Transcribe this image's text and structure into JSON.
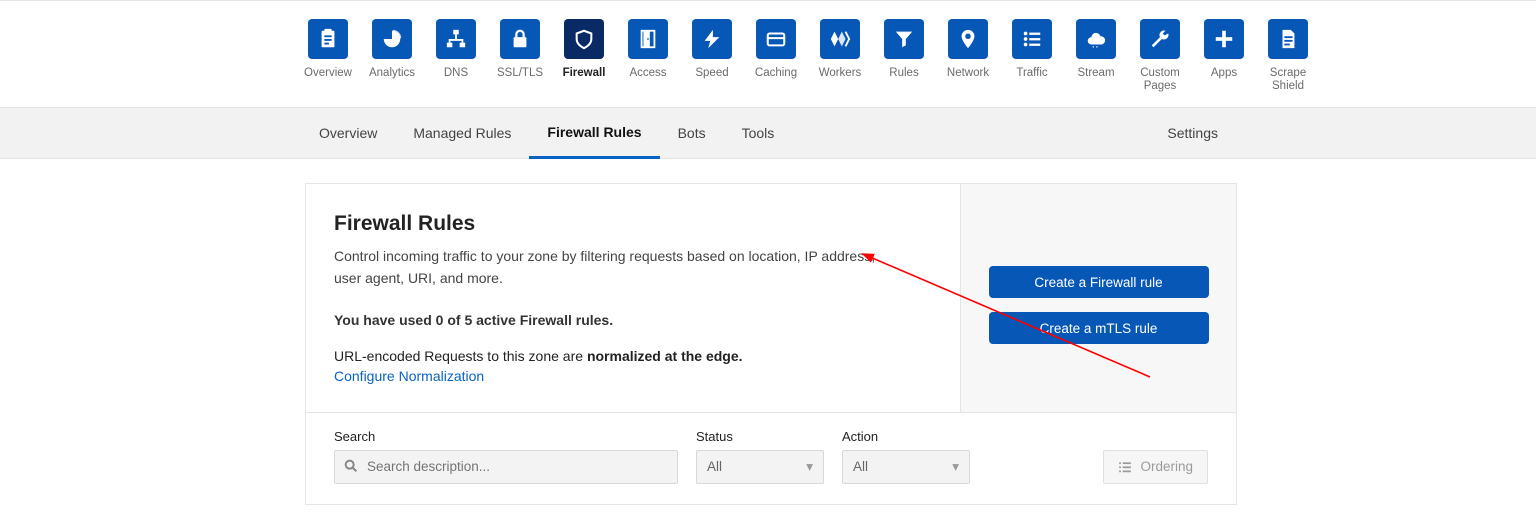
{
  "nav": [
    {
      "key": "overview",
      "label": "Overview",
      "icon": "clipboard"
    },
    {
      "key": "analytics",
      "label": "Analytics",
      "icon": "pie"
    },
    {
      "key": "dns",
      "label": "DNS",
      "icon": "sitemap"
    },
    {
      "key": "ssl",
      "label": "SSL/TLS",
      "icon": "lock"
    },
    {
      "key": "firewall",
      "label": "Firewall",
      "icon": "shield",
      "active": true
    },
    {
      "key": "access",
      "label": "Access",
      "icon": "door"
    },
    {
      "key": "speed",
      "label": "Speed",
      "icon": "bolt"
    },
    {
      "key": "caching",
      "label": "Caching",
      "icon": "card"
    },
    {
      "key": "workers",
      "label": "Workers",
      "icon": "workers"
    },
    {
      "key": "rules",
      "label": "Rules",
      "icon": "funnel"
    },
    {
      "key": "network",
      "label": "Network",
      "icon": "pin"
    },
    {
      "key": "traffic",
      "label": "Traffic",
      "icon": "list"
    },
    {
      "key": "stream",
      "label": "Stream",
      "icon": "cloud"
    },
    {
      "key": "custom",
      "label": "Custom\nPages",
      "icon": "wrench"
    },
    {
      "key": "apps",
      "label": "Apps",
      "icon": "plus"
    },
    {
      "key": "scrape",
      "label": "Scrape\nShield",
      "icon": "doc"
    }
  ],
  "tabs": {
    "items": [
      {
        "key": "overview",
        "label": "Overview"
      },
      {
        "key": "managed",
        "label": "Managed Rules"
      },
      {
        "key": "firewall-rules",
        "label": "Firewall Rules",
        "active": true
      },
      {
        "key": "bots",
        "label": "Bots"
      },
      {
        "key": "tools",
        "label": "Tools"
      }
    ],
    "settings": "Settings"
  },
  "panel": {
    "title": "Firewall Rules",
    "desc": "Control incoming traffic to your zone by filtering requests based on location, IP address, user agent, URI, and more.",
    "usage_pre": "You have used ",
    "usage_bold": "0 of 5",
    "usage_post": " active Firewall rules.",
    "url_pre": "URL-encoded Requests to this zone are ",
    "url_bold": "normalized at the edge.",
    "configure": "Configure Normalization",
    "btn_create": "Create a Firewall rule",
    "btn_mtls": "Create a mTLS rule"
  },
  "filters": {
    "search_label": "Search",
    "search_placeholder": "Search description...",
    "status_label": "Status",
    "status_value": "All",
    "action_label": "Action",
    "action_value": "All",
    "ordering": "Ordering"
  }
}
